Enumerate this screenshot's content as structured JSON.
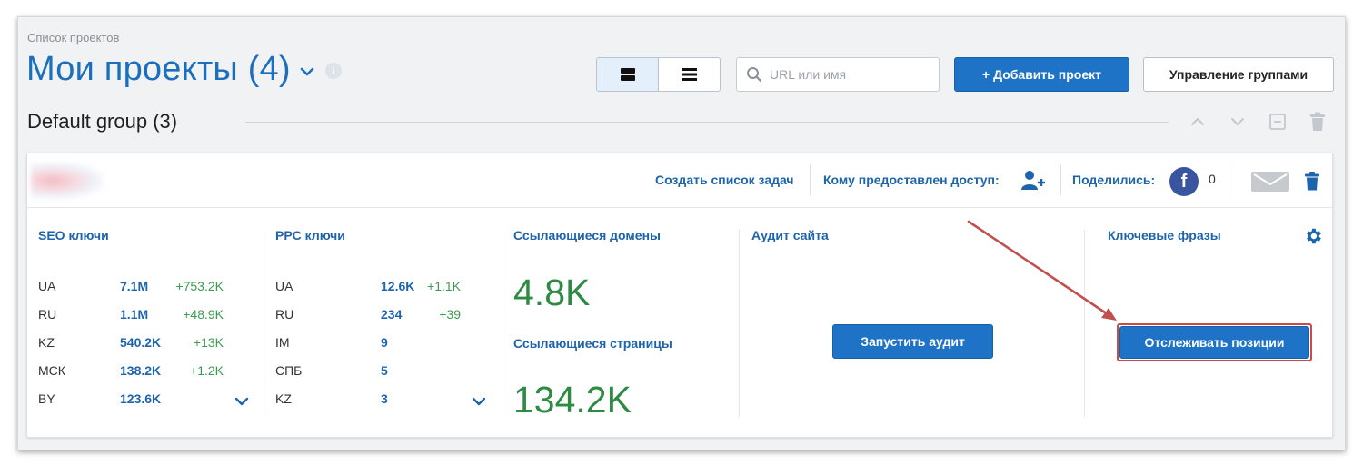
{
  "breadcrumb": "Список проектов",
  "page_title": "Мои проекты (4)",
  "search": {
    "placeholder": "URL или имя"
  },
  "toolbar": {
    "add_project_label": "+ Добавить проект",
    "manage_groups_label": "Управление группами"
  },
  "group": {
    "title": "Default group (3)"
  },
  "project_header": {
    "create_task_list": "Создать список задач",
    "access_label": "Кому предоставлен доступ:",
    "shared_label": "Поделились:",
    "facebook_count": "0"
  },
  "seo": {
    "title": "SEO ключи",
    "rows": [
      {
        "region": "UA",
        "value": "7.1M",
        "delta": "+753.2K"
      },
      {
        "region": "RU",
        "value": "1.1M",
        "delta": "+48.9K"
      },
      {
        "region": "KZ",
        "value": "540.2K",
        "delta": "+13K"
      },
      {
        "region": "МСК",
        "value": "138.2K",
        "delta": "+1.2K"
      },
      {
        "region": "BY",
        "value": "123.6K",
        "delta": ""
      }
    ]
  },
  "ppc": {
    "title": "PPC ключи",
    "rows": [
      {
        "region": "UA",
        "value": "12.6K",
        "delta": "+1.1K"
      },
      {
        "region": "RU",
        "value": "234",
        "delta": "+39"
      },
      {
        "region": "IM",
        "value": "9",
        "delta": ""
      },
      {
        "region": "СПБ",
        "value": "5",
        "delta": ""
      },
      {
        "region": "KZ",
        "value": "3",
        "delta": ""
      }
    ]
  },
  "backlinks": {
    "domains_title": "Ссылающиеся домены",
    "domains_value": "4.8K",
    "pages_title": "Ссылающиеся страницы",
    "pages_value": "134.2K"
  },
  "audit": {
    "title": "Аудит сайта",
    "run_label": "Запустить аудит"
  },
  "keywords": {
    "title": "Ключевые фразы",
    "track_label": "Отслеживать позиции"
  },
  "colors": {
    "accent": "#1e73c7",
    "link": "#1d64ad",
    "positive": "#3c9b52",
    "highlight": "#c94a4a",
    "facebook": "#3a559f"
  }
}
